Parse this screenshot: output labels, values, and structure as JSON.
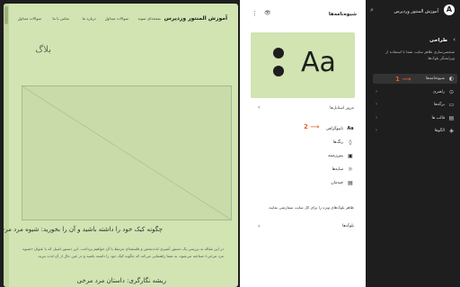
{
  "sidebar": {
    "site_title": "آموزش المنتور وردپرس",
    "section_title": "طراحی",
    "description": "شخصی‌سازی ظاهر سایت شما با استفاده از ویرایشگر بلوک‌ها.",
    "items": [
      {
        "label": "شیوه‌نامه‌ها",
        "icon": "half-circle-icon",
        "active": true
      },
      {
        "label": "راهبری",
        "icon": "navigation-icon"
      },
      {
        "label": "برگه‌ها",
        "icon": "page-icon"
      },
      {
        "label": "قالب ها",
        "icon": "layout-icon"
      },
      {
        "label": "الگوها",
        "icon": "patterns-icon"
      }
    ],
    "annotation": "1"
  },
  "panel": {
    "title": "شیوه‌نامه‌ها",
    "preview_text": "Aa",
    "browse_label": "مرور استایل‌ها",
    "rows": [
      {
        "label": "تایپوگرافی",
        "icon_text": "Aa"
      },
      {
        "label": "رنگ‌ها",
        "icon_text": "◊"
      },
      {
        "label": "پس‌زمینه",
        "icon_text": "▣"
      },
      {
        "label": "سایه‌ها",
        "icon_text": "☼"
      },
      {
        "label": "چیدمان",
        "icon_text": "▤"
      }
    ],
    "annotation": "2",
    "blocks_desc": "ظاهر بلوک‌های ویژه را برای کل سایت سفارشی نمایید.",
    "blocks_label": "بلوک‌ها"
  },
  "preview": {
    "site_title": "آموزش المنتور وردپرس",
    "nav": [
      "صفحه‌ای نمونه",
      "سوالات متداول",
      "درباره ما",
      "تماس با ما",
      "سوالات متداول"
    ],
    "blog_title": "بلاگ",
    "post_title": "چگونه کیک خود را داشته باشید و آن را بخورید: شیوه مرد مرخی",
    "post_excerpt": "در این مقاله به بررسی یک دستور آشپزی لذت‌بخش و فلسفه‌ای مرتبط با آن خواهیم پرداخت. این دستور اصیل که با عنوان «شیوه مرد مرخی» شناخته می‌شود، به شما راهنمایی می‌کند که چگونه کیک خود را داشته باشید و در عین حال از آن لذت ببرید.",
    "post2_title": "ریشه نگارگری: داستان مرد مرخی"
  },
  "colors": {
    "accent": "#e85c2a",
    "preview_bg": "#d1e4b2",
    "sidebar_bg": "#1e1e1e"
  }
}
